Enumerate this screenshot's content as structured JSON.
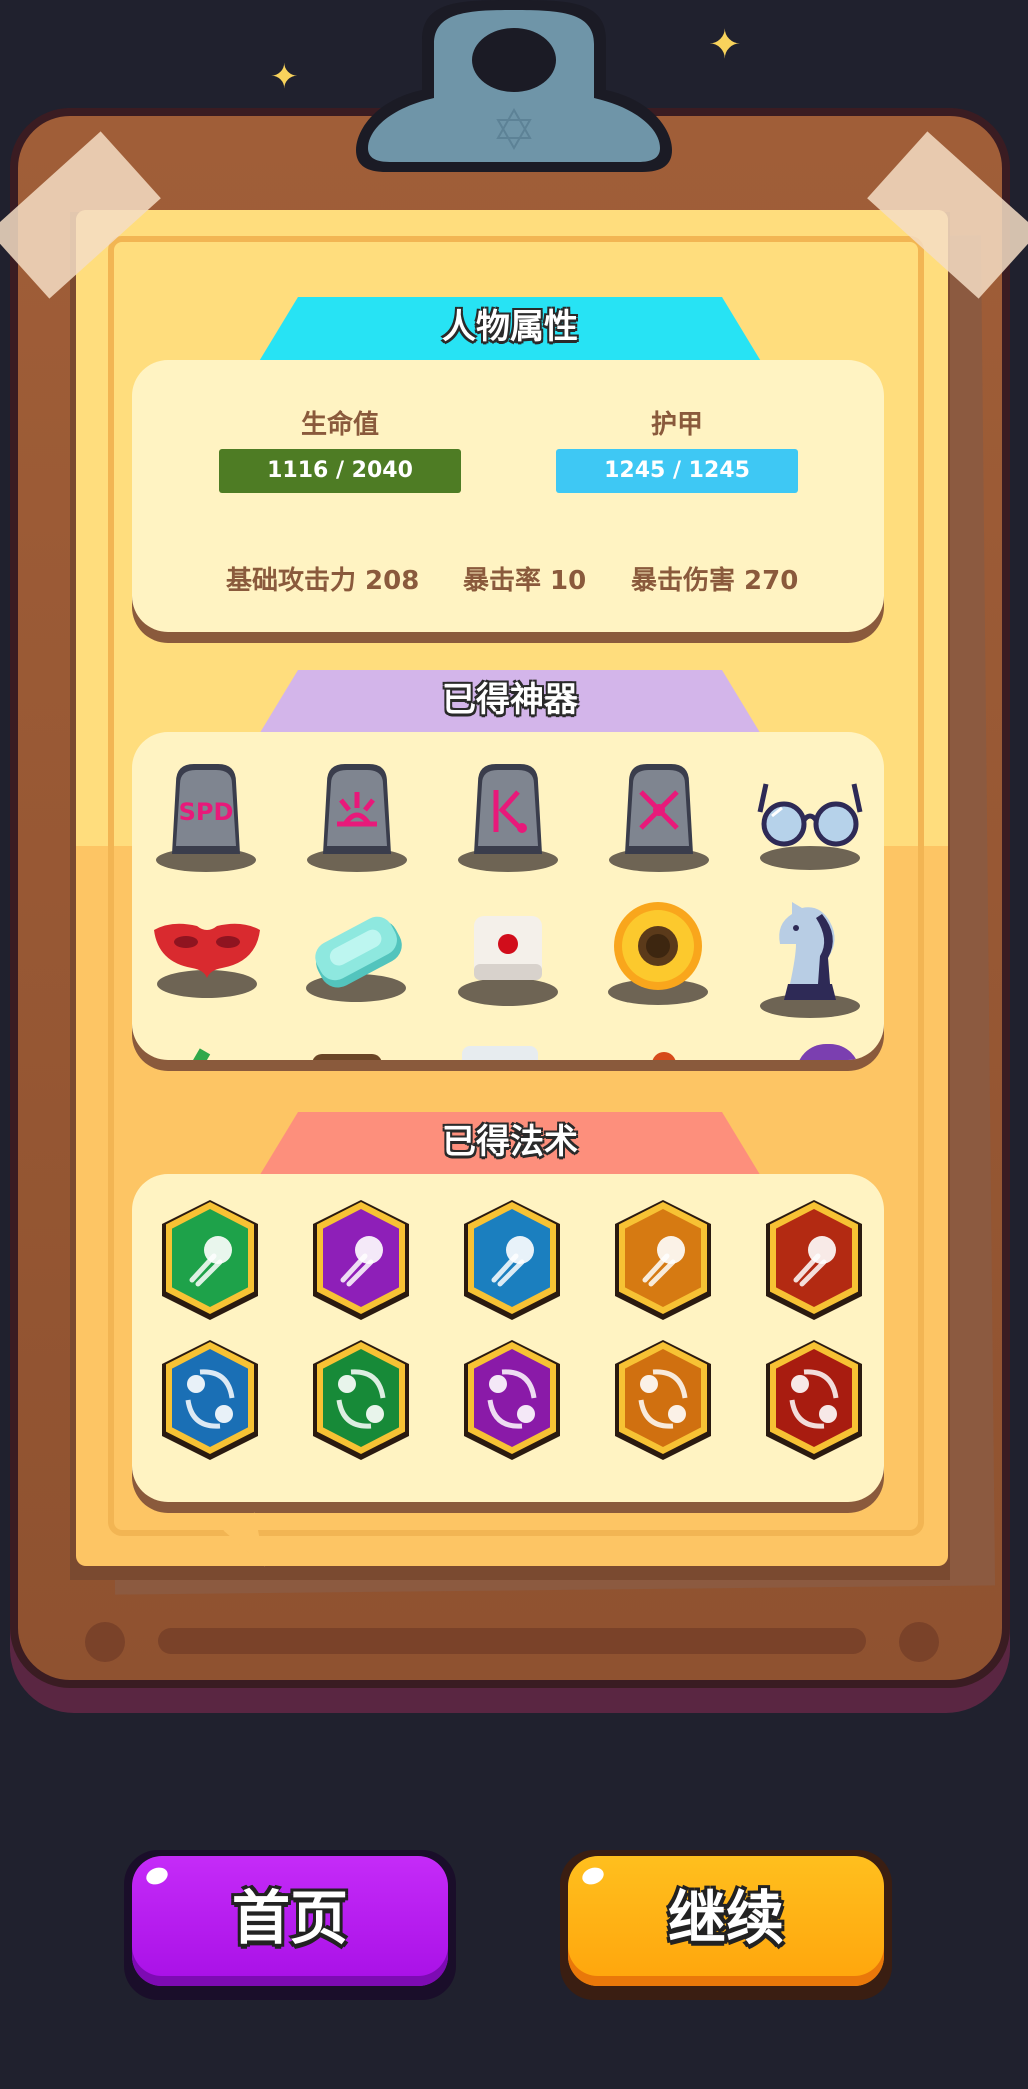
{
  "stats": {
    "title": "人物属性",
    "hp_label": "生命值",
    "hp_value": "1116 / 2040",
    "armor_label": "护甲",
    "armor_value": "1245 / 1245",
    "attack": "基础攻击力 208",
    "crit_rate": "暴击率 10",
    "crit_damage": "暴击伤害 270"
  },
  "artifacts": {
    "title": "已得神器",
    "items": [
      {
        "icon": "speed-rune-stone",
        "glyph": "SPD"
      },
      {
        "icon": "burst-rune-stone",
        "glyph": "⚡"
      },
      {
        "icon": "knockback-rune-stone",
        "glyph": "|<"
      },
      {
        "icon": "scatter-rune-stone",
        "glyph": "✕"
      },
      {
        "icon": "glasses"
      },
      {
        "icon": "red-mask"
      },
      {
        "icon": "soap-bar"
      },
      {
        "icon": "dice"
      },
      {
        "icon": "sunflower"
      },
      {
        "icon": "chess-knight"
      }
    ]
  },
  "spells": {
    "title": "已得法术",
    "items": [
      {
        "icon": "green-shot-badge",
        "color": "#1ea24a"
      },
      {
        "icon": "purple-shot-badge",
        "color": "#8e1fb8"
      },
      {
        "icon": "blue-shot-badge",
        "color": "#1b7fbf"
      },
      {
        "icon": "orange-shot-badge",
        "color": "#d67a12"
      },
      {
        "icon": "red-shot-badge",
        "color": "#b32a12"
      },
      {
        "icon": "blue-orbit-badge",
        "color": "#1a6fb5"
      },
      {
        "icon": "green-orbit-badge",
        "color": "#178a38"
      },
      {
        "icon": "purple-orbit-badge",
        "color": "#8a1aa8"
      },
      {
        "icon": "orange-orbit-badge",
        "color": "#d07010"
      },
      {
        "icon": "red-orbit-badge",
        "color": "#a81c10"
      }
    ]
  },
  "buttons": {
    "home": "首页",
    "continue": "继续"
  },
  "colors": {
    "hp_bar": "#4e7c24",
    "armor_bar": "#3ec8f4",
    "stats_header": "#27e3f4",
    "artifacts_header": "#d3b5ea",
    "spells_header": "#fd8f7c",
    "home_button": "#b315f1",
    "continue_button": "#ffad14"
  }
}
